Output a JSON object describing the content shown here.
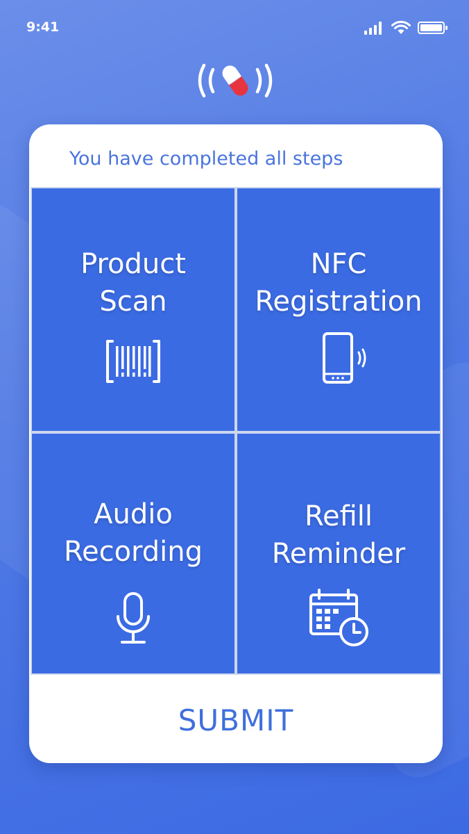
{
  "status_bar": {
    "time": "9:41",
    "icons": [
      "cellular-signal-icon",
      "wifi-icon",
      "battery-icon"
    ]
  },
  "app_logo": {
    "icon": "pill-signal-icon",
    "colors": {
      "pill_red": "#e8343f",
      "pill_white": "#ffffff"
    }
  },
  "card": {
    "header": "You have completed all steps",
    "tiles": [
      {
        "line1": "Product",
        "line2": "Scan",
        "icon": "barcode-scan-icon"
      },
      {
        "line1": "NFC",
        "line2": "Registration",
        "icon": "phone-nfc-icon"
      },
      {
        "line1": "Audio",
        "line2": "Recording",
        "icon": "microphone-icon"
      },
      {
        "line1": "Refill",
        "line2": "Reminder",
        "icon": "calendar-clock-icon"
      }
    ],
    "submit_label": "SUBMIT"
  },
  "colors": {
    "background": "#4f79e4",
    "tile": "#3b6be3",
    "accent_text": "#4a74dc",
    "card": "#ffffff"
  }
}
